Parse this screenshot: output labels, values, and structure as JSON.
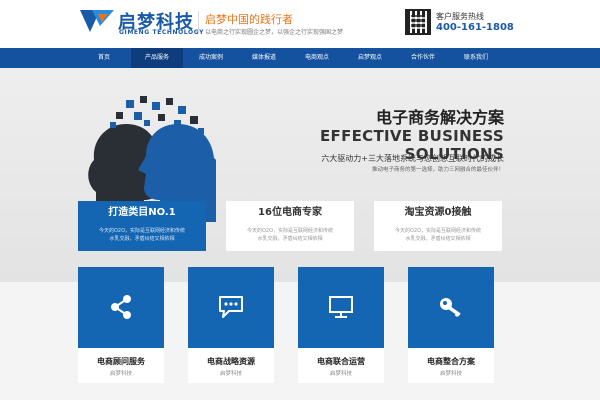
{
  "header": {
    "logo_cn": "启梦科技",
    "logo_en": "GIMENG TECHNOLOGY",
    "slogan": "启梦中国的践行者",
    "slogan_sub": "以电商之行实现圆企之梦，以强企之行实现强国之梦",
    "hotline_label": "客户服务热线",
    "hotline": "400-161-1808",
    "brand_color": "#1a5aa6",
    "accent_color": "#e8751a"
  },
  "nav": {
    "items": [
      {
        "label": "首页"
      },
      {
        "label": "产品服务"
      },
      {
        "label": "成功案例"
      },
      {
        "label": "媒体报道"
      },
      {
        "label": "电商观点"
      },
      {
        "label": "启梦观点"
      },
      {
        "label": "合作伙伴"
      },
      {
        "label": "联系我们"
      }
    ],
    "active_index": 1,
    "bg_color": "#14519f"
  },
  "banner": {
    "title_cn": "电子商务解决方案",
    "title_en": "EFFECTIVE BUSINESS SOLUTIONS",
    "sub1": "六大驱动力+三大落地系统与您创想互联时代的成长",
    "sub2": "推动电子商务的第一选择，助力三网融合的最佳伙伴！",
    "cards": [
      {
        "title": "打造类目NO.1",
        "desc1": "今天的O2O，实际是互联网经济和传统",
        "desc2": "水乳交融，矛盾纠结又相依相",
        "style": "blue"
      },
      {
        "title": "16位电商专家",
        "desc1": "今天的O2O，实际是互联网经济和传统",
        "desc2": "水乳交融，矛盾纠结又相依相",
        "style": "white"
      },
      {
        "title": "淘宝资源0接触",
        "desc1": "今天的O2O，实际是互联网经济和传统",
        "desc2": "水乳交融，矛盾纠结又相依相",
        "style": "white"
      }
    ]
  },
  "services": [
    {
      "name": "电商顾问服务",
      "sub": "启梦科技",
      "icon": "share-icon"
    },
    {
      "name": "电商战略资源",
      "sub": "启梦科技",
      "icon": "chat-icon"
    },
    {
      "name": "电商联合运营",
      "sub": "启梦科技",
      "icon": "monitor-icon"
    },
    {
      "name": "电商整合方案",
      "sub": "启梦科技",
      "icon": "key-icon"
    }
  ]
}
